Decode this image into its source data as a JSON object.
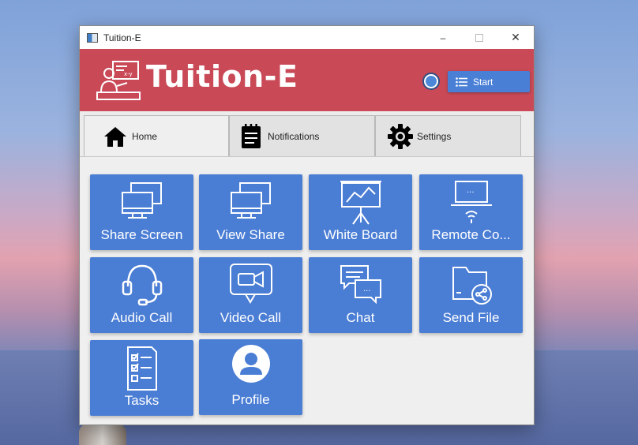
{
  "window": {
    "title": "Tuition-E"
  },
  "header": {
    "brand": "Tuition-E",
    "start_label": "Start"
  },
  "tabs": [
    {
      "label": "Home",
      "icon": "home-icon"
    },
    {
      "label": "Notifications",
      "icon": "notepad-icon"
    },
    {
      "label": "Settings",
      "icon": "gear-icon"
    }
  ],
  "tiles": [
    {
      "label": "Share Screen",
      "icon": "screens-icon"
    },
    {
      "label": "View Share",
      "icon": "screens-icon"
    },
    {
      "label": "White Board",
      "icon": "whiteboard-icon"
    },
    {
      "label": "Remote Co...",
      "icon": "remote-laptop-icon"
    },
    {
      "label": "Audio Call",
      "icon": "headset-icon"
    },
    {
      "label": "Video Call",
      "icon": "video-call-icon"
    },
    {
      "label": "Chat",
      "icon": "chat-bubbles-icon"
    },
    {
      "label": "Send File",
      "icon": "folder-share-icon"
    },
    {
      "label": "Tasks",
      "icon": "checklist-icon"
    },
    {
      "label": "Profile",
      "icon": "user-avatar-icon"
    }
  ],
  "colors": {
    "header": "#c94957",
    "tile": "#4a7dd4",
    "start_button": "#4a7fd6"
  }
}
